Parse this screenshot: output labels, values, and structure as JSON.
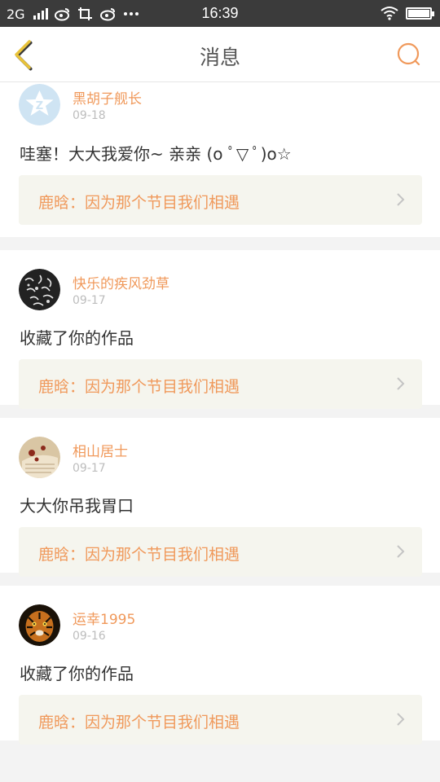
{
  "status_bar": {
    "network": "2G",
    "time": "16:39",
    "battery_level": 1.0
  },
  "header": {
    "title": "消息",
    "back_icon": "chevron-left-icon",
    "search_icon": "search-icon"
  },
  "messages": [
    {
      "username": "黑胡子舰长",
      "date": "09-18",
      "text": "哇塞！大大我爱你~ 亲亲 (o ﾟ▽ ﾟ)o☆",
      "quote": "鹿晗：因为那个节目我们相遇"
    },
    {
      "username": "快乐的疾风劲草",
      "date": "09-17",
      "text": "收藏了你的作品",
      "quote": "鹿晗：因为那个节目我们相遇"
    },
    {
      "username": "相山居士",
      "date": "09-17",
      "text": "大大你吊我胃口",
      "quote": "鹿晗：因为那个节目我们相遇"
    },
    {
      "username": "运幸1995",
      "date": "09-16",
      "text": "收藏了你的作品",
      "quote": "鹿晗：因为那个节目我们相遇"
    }
  ],
  "colors": {
    "accent": "#f0995b",
    "back_arrow": "#c8a414",
    "status_bar": "#3b3b3b"
  }
}
